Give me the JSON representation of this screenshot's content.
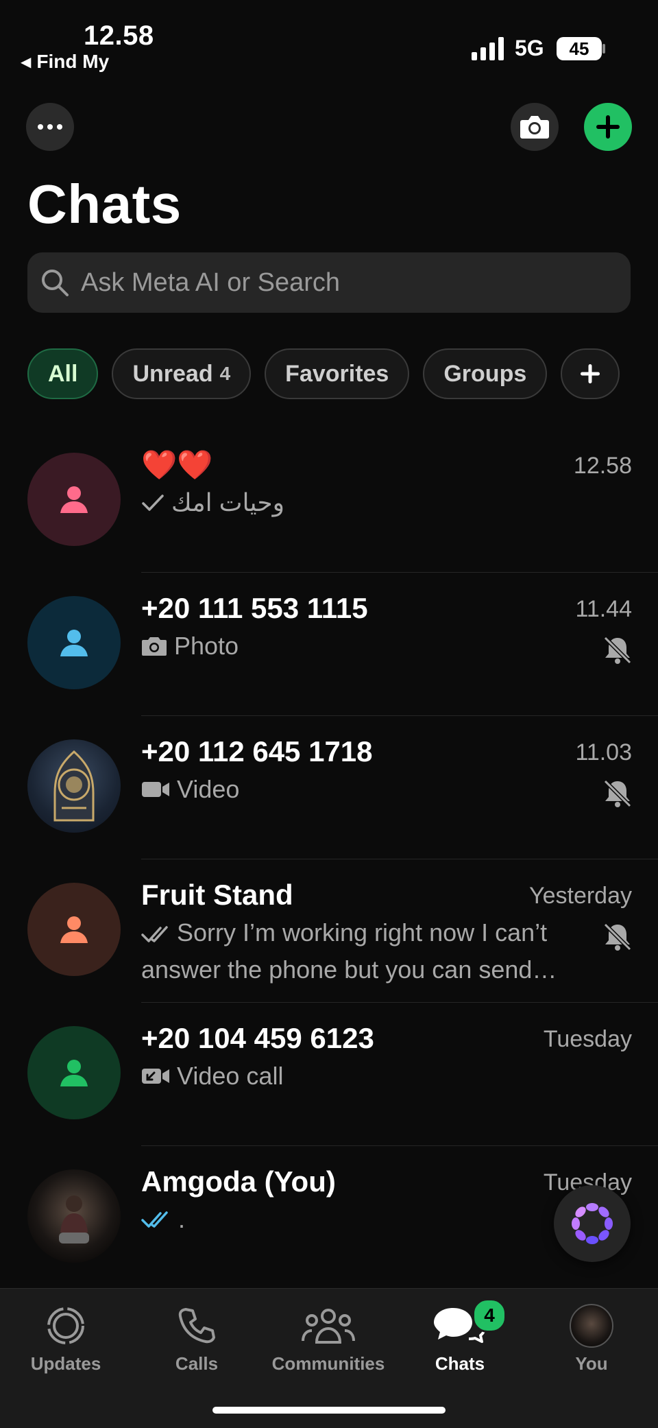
{
  "status_bar": {
    "time": "12.58",
    "back_app": "Find My",
    "network": "5G",
    "battery": "45"
  },
  "header": {
    "title": "Chats"
  },
  "search": {
    "placeholder": "Ask Meta AI or Search"
  },
  "filters": [
    {
      "label": "All",
      "count": ""
    },
    {
      "label": "Unread",
      "count": "4"
    },
    {
      "label": "Favorites",
      "count": ""
    },
    {
      "label": "Groups",
      "count": ""
    }
  ],
  "chats": [
    {
      "name": "❤️❤️",
      "time": "12.58",
      "preview": "وحيات امك",
      "status": "sent",
      "muted": false,
      "avatar_color": "#3a1a24",
      "avatar_icon_color": "#ff6b8b"
    },
    {
      "name": "+20 111 553 1115",
      "time": "11.44",
      "preview": "Photo",
      "status": "photo",
      "muted": true,
      "avatar_color": "#0c2a3a",
      "avatar_icon_color": "#53bdeb"
    },
    {
      "name": "+20 112 645 1718",
      "time": "11.03",
      "preview": "Video",
      "status": "video",
      "muted": true,
      "avatar_color": "#1f2a3d",
      "avatar_icon_color": "#c8a96a"
    },
    {
      "name": "Fruit Stand",
      "time": "Yesterday",
      "preview": "Sorry I’m working right now I can’t answer the phone but you can send…",
      "status": "delivered",
      "muted": true,
      "avatar_color": "#3a221c",
      "avatar_icon_color": "#ff8a65"
    },
    {
      "name": "+20 104 459 6123",
      "time": "Tuesday",
      "preview": "Video call",
      "status": "video-call",
      "muted": false,
      "avatar_color": "#0f3a24",
      "avatar_icon_color": "#21c063"
    },
    {
      "name": "Amgoda (You)",
      "time": "Tuesday",
      "preview": ".",
      "status": "read",
      "muted": false,
      "avatar_color": "#222222",
      "avatar_icon_color": "#8a6a5a"
    }
  ],
  "tabs": [
    {
      "label": "Updates",
      "icon": "updates-icon"
    },
    {
      "label": "Calls",
      "icon": "phone-icon"
    },
    {
      "label": "Communities",
      "icon": "communities-icon"
    },
    {
      "label": "Chats",
      "icon": "chats-icon",
      "badge": "4",
      "active": true
    },
    {
      "label": "You",
      "icon": "profile-avatar"
    }
  ],
  "colors": {
    "accent": "#21c063",
    "background": "#0b0b0b",
    "read_tick": "#53bdeb"
  }
}
